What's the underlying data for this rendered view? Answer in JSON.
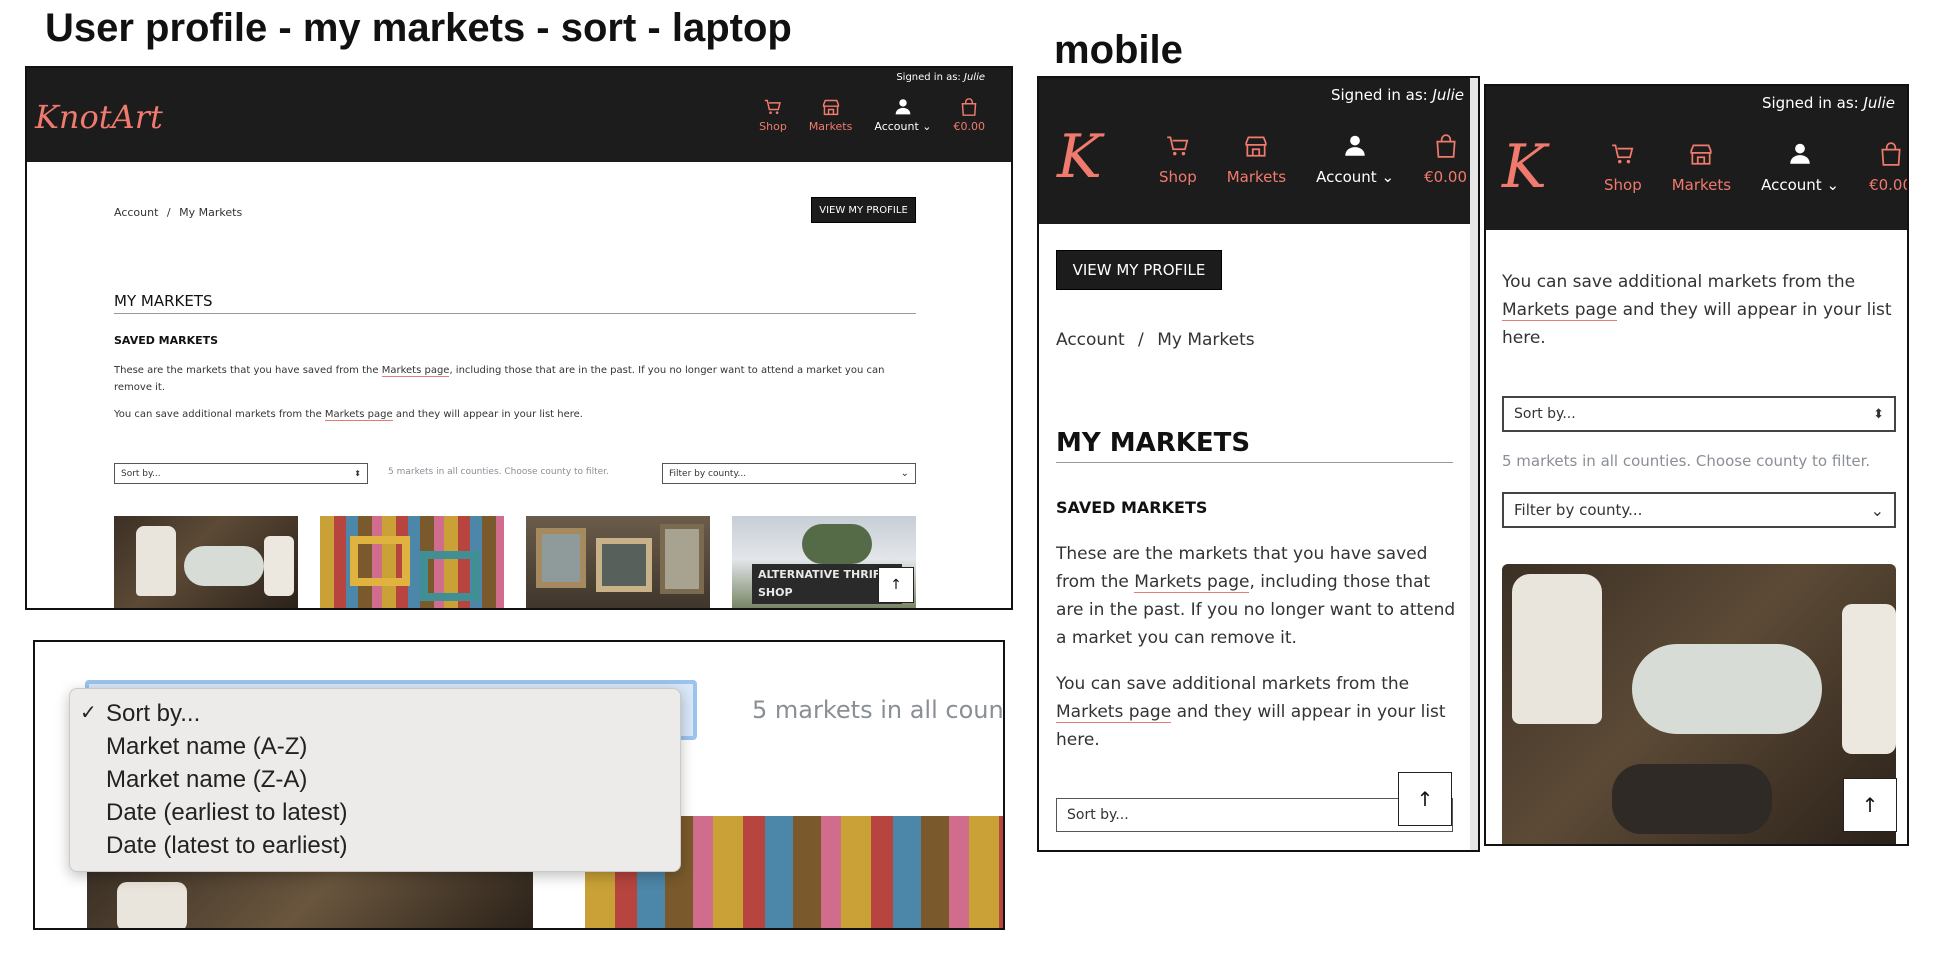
{
  "headings": {
    "laptop": "User profile - my markets - sort - laptop",
    "mobile": "mobile"
  },
  "header": {
    "signed_in_label": "Signed in as:",
    "signed_in_user": "Julie",
    "logo_text": "KnotArt",
    "logo_mobile": "K",
    "nav": {
      "shop": "Shop",
      "markets": "Markets",
      "account": "Account",
      "cart": "€0.00"
    },
    "accent_color": "#f07a6e",
    "header_bg": "#1c1c1c"
  },
  "page": {
    "breadcrumb_account": "Account",
    "breadcrumb_sep": "/",
    "breadcrumb_current": "My Markets",
    "view_profile_button": "VIEW MY PROFILE",
    "title": "MY MARKETS",
    "subtitle": "SAVED MARKETS",
    "para1_before": "These are the markets that you have saved from the",
    "para1_link": "Markets page",
    "para1_after": ", including those that are in the past. If you no longer want to attend a market you can remove it.",
    "para2_before": "You can save additional markets from the",
    "para2_link": "Markets page",
    "para2_after": "and they will appear in your list here.",
    "sort_placeholder": "Sort by...",
    "count_text": "5 markets in all counties. Choose county to filter.",
    "filter_placeholder": "Filter by county...",
    "totop": "↑"
  },
  "sort_dropdown": {
    "options": [
      "Sort by...",
      "Market name (A-Z)",
      "Market name (Z-A)",
      "Date (earliest to latest)",
      "Date (latest to earliest)"
    ],
    "selected_index": 0,
    "check": "✓",
    "cropped_count_text": "5 markets in all countie"
  },
  "market_cards": [
    {
      "image": "vintage-china-photo"
    },
    {
      "image": "colorful-frames-photo"
    },
    {
      "image": "picture-frames-stall-photo"
    },
    {
      "image": "thrift-shop-sign-photo",
      "sign_text": "ALTERNATIVE THRIFT SHOP"
    }
  ]
}
